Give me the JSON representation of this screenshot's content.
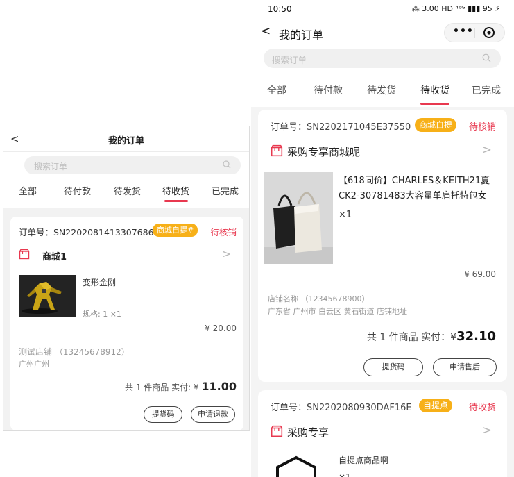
{
  "left_screen": {
    "title": "我的订单",
    "back_glyph": "<",
    "search_placeholder": "搜索订单",
    "tabs": [
      "全部",
      "待付款",
      "待发货",
      "待收货",
      "已完成"
    ],
    "active_tab": "待收货",
    "order": {
      "order_no": "订单号：SN2202081413307686",
      "badge": "商城自提#",
      "status": "待核销",
      "shop": "商城1",
      "product": "变形金刚",
      "spec": "规格: 1  ×1",
      "price": "¥ 20.00",
      "store": "测试店铺 （13245678912）",
      "city": "广州广州",
      "total_prefix": "共 1 件商品  实付: ¥ ",
      "total_amount": "11.00",
      "buttons": [
        "提货码",
        "申请退款"
      ]
    }
  },
  "right_screen": {
    "status_bar": {
      "time": "10:50",
      "icons": "⁂ 3.00 HD ⁴⁶ᴳ ▮▮▮ 95 ⚡"
    },
    "title": "我的订单",
    "back_glyph": "<",
    "capsule_dots": "•••",
    "search_placeholder": "搜索订单",
    "tabs": [
      "全部",
      "待付款",
      "待发货",
      "待收货",
      "已完成"
    ],
    "active_tab": "待收货",
    "orders": [
      {
        "order_no": "订单号：SN2202171045E37550",
        "badge": "商城自提",
        "status": "待核销",
        "shop": "采购专享商城呢",
        "product": "【618同价】CHARLES＆KEITH21夏CK2-30781483大容量单肩托特包女",
        "qty": "×1",
        "price": "¥ 69.00",
        "store": "店铺名称 （12345678900）",
        "address": "广东省 广州市 白云区 黄石街道 店铺地址",
        "total_prefix": "共 1 件商品  实付：¥",
        "total_amount": "32.10",
        "buttons": [
          "提货码",
          "申请售后"
        ]
      },
      {
        "order_no": "订单号：SN2202080930DAF16E",
        "badge": "自提点",
        "status": "待收货",
        "shop": "采购专享",
        "product": "自提点商品啊",
        "qty": "×1"
      }
    ]
  },
  "colors": {
    "accent_red": "#e8384f",
    "badge_orange": "#f7b018",
    "background_gray": "#f4f4f4"
  },
  "icons": [
    "back-icon",
    "search-icon",
    "shop-icon",
    "chevron-right-icon",
    "more-dots-icon",
    "close-target-icon",
    "package-icon"
  ]
}
